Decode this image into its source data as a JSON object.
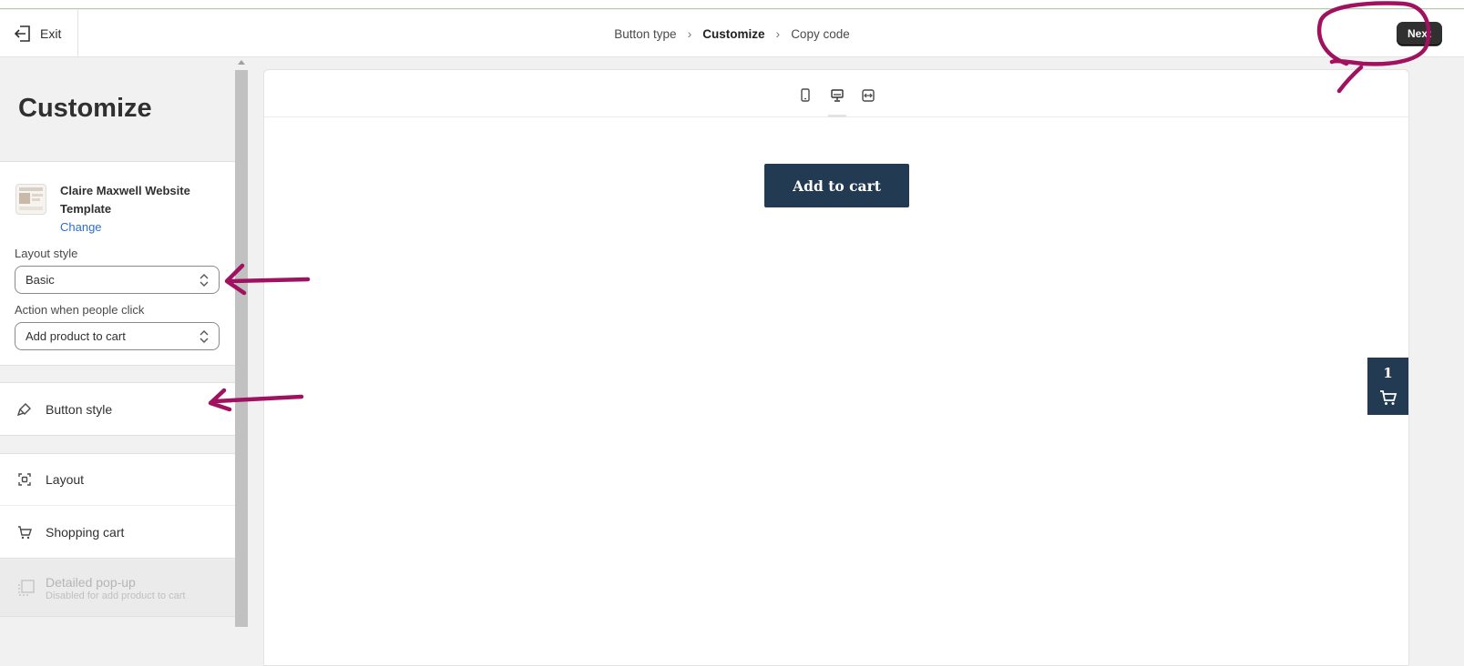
{
  "header": {
    "exit_label": "Exit",
    "breadcrumbs": [
      "Button type",
      "Customize",
      "Copy code"
    ],
    "next_label": "Next"
  },
  "sidebar": {
    "title": "Customize",
    "template": {
      "name": "Claire Maxwell Website Template",
      "change_label": "Change"
    },
    "layout_style": {
      "label": "Layout style",
      "value": "Basic"
    },
    "click_action": {
      "label": "Action when people click",
      "value": "Add product to cart"
    },
    "sections": {
      "button_style": "Button style",
      "layout": "Layout",
      "shopping_cart": "Shopping cart",
      "detailed_popup": "Detailed pop-up",
      "detailed_popup_note": "Disabled for add product to cart"
    }
  },
  "preview": {
    "button_label": "Add to cart",
    "cart_count": "1",
    "devices": [
      "mobile-icon",
      "desktop-icon",
      "fullwidth-icon"
    ]
  },
  "colors": {
    "accent_button": "#233a53",
    "primary_button": "#303030",
    "link": "#2c6ecb",
    "annotation": "#a0125f"
  }
}
